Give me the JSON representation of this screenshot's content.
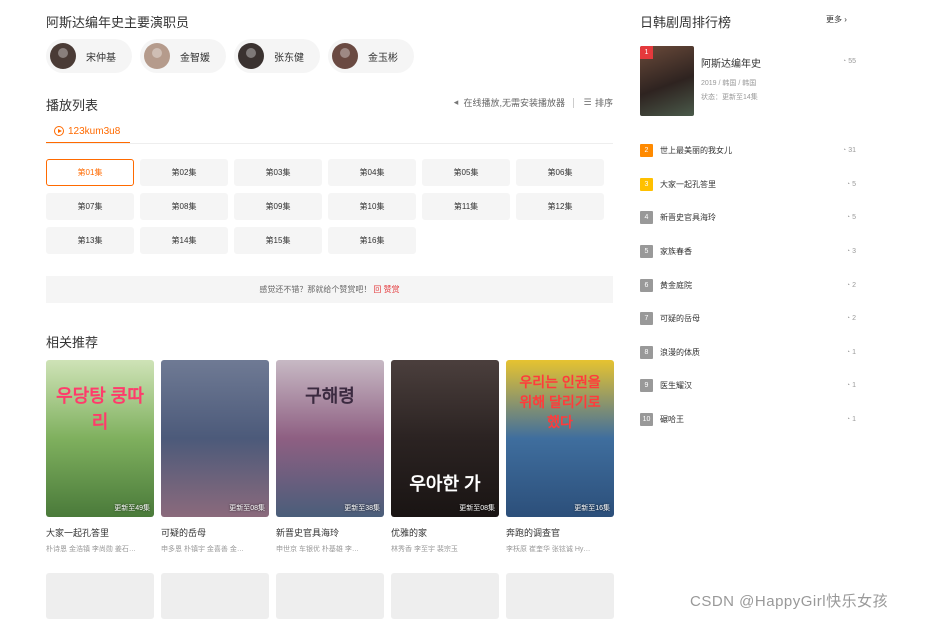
{
  "cast": {
    "title": "阿斯达编年史主要演职员",
    "members": [
      {
        "name": "宋仲基",
        "color": "#4a3b36"
      },
      {
        "name": "金智媛",
        "color": "#b59b8c"
      },
      {
        "name": "张东健",
        "color": "#3a3230"
      },
      {
        "name": "金玉彬",
        "color": "#6a4a42"
      }
    ]
  },
  "playlist": {
    "title": "播放列表",
    "tools": {
      "play_tip": "在线播放,无需安装播放器",
      "sort_label": "排序"
    },
    "source_tab": "123kum3u8",
    "episodes": [
      "第01集",
      "第02集",
      "第03集",
      "第04集",
      "第05集",
      "第06集",
      "第07集",
      "第08集",
      "第09集",
      "第10集",
      "第11集",
      "第12集",
      "第13集",
      "第14集",
      "第15集",
      "第16集"
    ],
    "active_episode": "第01集",
    "reward": {
      "text": "感觉还不错？那就给个赞赏吧！",
      "link_icon": "回",
      "link": "赞赏"
    }
  },
  "recommend": {
    "title": "相关推荐",
    "items": [
      {
        "name": "大家一起孔答里",
        "cast": "朴诗恩 金浩镇 李尚勋 姜石…",
        "update": "更新至49集",
        "colors": [
          "#cfe3b7",
          "#7fb05e",
          "#4a7a3a"
        ],
        "poster_text": "우당탕 쿵따리",
        "text_color": "#ff3b6b"
      },
      {
        "name": "可疑的岳母",
        "cast": "申多恩 朴镇宇 金喜善 金…",
        "update": "更新至08集",
        "colors": [
          "#6f7a94",
          "#4c5a7a",
          "#8b6a7c"
        ],
        "poster_text": "",
        "text_color": "#ffffff"
      },
      {
        "name": "新晋史官具海玲",
        "cast": "申世京 车银优 朴基雄 李…",
        "update": "更新至38集",
        "colors": [
          "#c7b9c4",
          "#8e5f82",
          "#4a5e7a"
        ],
        "poster_text": "구해령",
        "text_color": "#3b2a40"
      },
      {
        "name": "优雅的家",
        "cast": "林秀香 李至宇 裴宗玉",
        "update": "更新至08集",
        "colors": [
          "#4b3f3d",
          "#2b2322",
          "#191413"
        ],
        "poster_text": "우아한 가",
        "text_color": "#ffffff"
      },
      {
        "name": "奔跑的调查官",
        "cast": "李枖原 崔奎华 张铉诚 Hy…",
        "update": "更新至16集",
        "colors": [
          "#e6c330",
          "#3f6e9e",
          "#2c4f7a"
        ],
        "poster_text": "우리는 인권을 위해 달리기로 했다",
        "text_color": "#ff3b3b"
      }
    ],
    "placeholder_count": 5
  },
  "ranking": {
    "title": "日韩剧周排行榜",
    "more": "更多 ›",
    "top": {
      "rank": "1",
      "name": "阿斯达编年史",
      "meta": "2019 / 韩国 / 韩国",
      "status": "状态：更新至14集",
      "count": "55"
    },
    "items": [
      {
        "rank": "2",
        "name": "世上最美丽的我女儿",
        "count": "31"
      },
      {
        "rank": "3",
        "name": "大家一起孔答里",
        "count": "5"
      },
      {
        "rank": "4",
        "name": "新晋史官具海玲",
        "count": "5"
      },
      {
        "rank": "5",
        "name": "家族春香",
        "count": "3"
      },
      {
        "rank": "6",
        "name": "黄金庭院",
        "count": "2"
      },
      {
        "rank": "7",
        "name": "可疑的岳母",
        "count": "2"
      },
      {
        "rank": "8",
        "name": "浪漫的体质",
        "count": "1"
      },
      {
        "rank": "9",
        "name": "医生耀汉",
        "count": "1"
      },
      {
        "rank": "10",
        "name": "碾哈王",
        "count": "1"
      }
    ]
  },
  "watermark": "CSDN @HappyGirl快乐女孩",
  "icons": {
    "sound": "speaker-icon",
    "sort": "list-icon",
    "heat": "flame-icon",
    "play": "play-circle-icon"
  }
}
